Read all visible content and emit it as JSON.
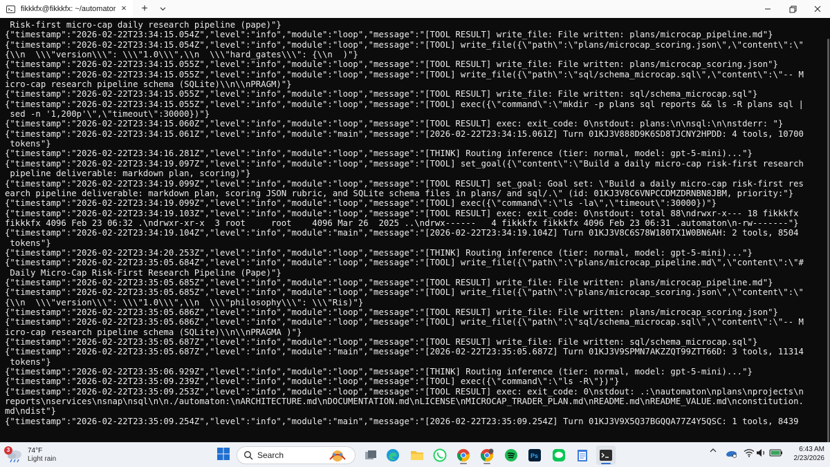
{
  "tab": {
    "title": "fikkkfx@fikkkfx: ~/automator",
    "icon": "terminal-icon",
    "close_label": "×",
    "new_tab_label": "+"
  },
  "terminal": {
    "lines": [
      " Risk-first micro-cap daily research pipeline (pape)\"}",
      "{\"timestamp\":\"2026-02-22T23:34:15.054Z\",\"level\":\"info\",\"module\":\"loop\",\"message\":\"[TOOL RESULT] write_file: File written: plans/microcap_pipeline.md\"}",
      "{\"timestamp\":\"2026-02-22T23:34:15.054Z\",\"level\":\"info\",\"module\":\"loop\",\"message\":\"[TOOL] write_file({\\\"path\\\":\\\"plans/microcap_scoring.json\\\",\\\"content\\\":\\\"",
      "{\\\\n  \\\\\\\"version\\\\\\\": \\\\\\\"1.0\\\\\\\",\\\\n  \\\\\\\"hard_gates\\\\\\\": {\\\\n  )\"}",
      "{\"timestamp\":\"2026-02-22T23:34:15.055Z\",\"level\":\"info\",\"module\":\"loop\",\"message\":\"[TOOL RESULT] write_file: File written: plans/microcap_scoring.json\"}",
      "{\"timestamp\":\"2026-02-22T23:34:15.055Z\",\"level\":\"info\",\"module\":\"loop\",\"message\":\"[TOOL] write_file({\\\"path\\\":\\\"sql/schema_microcap.sql\\\",\\\"content\\\":\\\"-- M",
      "icro-cap research pipeline schema (SQLite)\\\\n\\\\nPRAGM)\"}",
      "{\"timestamp\":\"2026-02-22T23:34:15.055Z\",\"level\":\"info\",\"module\":\"loop\",\"message\":\"[TOOL RESULT] write_file: File written: sql/schema_microcap.sql\"}",
      "{\"timestamp\":\"2026-02-22T23:34:15.055Z\",\"level\":\"info\",\"module\":\"loop\",\"message\":\"[TOOL] exec({\\\"command\\\":\\\"mkdir -p plans sql reports && ls -R plans sql |",
      " sed -n '1,200p'\\\",\\\"timeout\\\":30000})\"}",
      "{\"timestamp\":\"2026-02-22T23:34:15.060Z\",\"level\":\"info\",\"module\":\"loop\",\"message\":\"[TOOL RESULT] exec: exit_code: 0\\nstdout: plans:\\n\\nsql:\\n\\nstderr: \"}",
      "{\"timestamp\":\"2026-02-22T23:34:15.061Z\",\"level\":\"info\",\"module\":\"main\",\"message\":\"[2026-02-22T23:34:15.061Z] Turn 01KJ3V888D9K6SD8TJCNY2HPDD: 4 tools, 10700",
      " tokens\"}",
      "{\"timestamp\":\"2026-02-22T23:34:16.281Z\",\"level\":\"info\",\"module\":\"loop\",\"message\":\"[THINK] Routing inference (tier: normal, model: gpt-5-mini)...\"}",
      "{\"timestamp\":\"2026-02-22T23:34:19.097Z\",\"level\":\"info\",\"module\":\"loop\",\"message\":\"[TOOL] set_goal({\\\"content\\\":\\\"Build a daily micro-cap risk-first research",
      " pipeline deliverable: markdown plan, scoring)\"}",
      "{\"timestamp\":\"2026-02-22T23:34:19.099Z\",\"level\":\"info\",\"module\":\"loop\",\"message\":\"[TOOL RESULT] set_goal: Goal set: \\\"Build a daily micro-cap risk-first res",
      "earch pipeline deliverable: markdown plan, scoring JSON rubric, and SQLite schema files in plans/ and sql/.\\\" (id: 01KJ3V8C6VNPCCDMZDRNBN8JBM, priority:\"}",
      "{\"timestamp\":\"2026-02-22T23:34:19.099Z\",\"level\":\"info\",\"module\":\"loop\",\"message\":\"[TOOL] exec({\\\"command\\\":\\\"ls -la\\\",\\\"timeout\\\":30000})\"}",
      "{\"timestamp\":\"2026-02-22T23:34:19.103Z\",\"level\":\"info\",\"module\":\"loop\",\"message\":\"[TOOL RESULT] exec: exit_code: 0\\nstdout: total 88\\ndrwxr-x--- 18 fikkkfx",
      "fikkkfx 4096 Feb 23 06:32 .\\ndrwxr-xr-x  3 root     root    4096 Mar 26  2025 ..\\ndrwx------   4 fikkkfx fikkkfx 4096 Feb 23 06:31 .automaton\\n-rw-------\"}",
      "{\"timestamp\":\"2026-02-22T23:34:19.104Z\",\"level\":\"info\",\"module\":\"main\",\"message\":\"[2026-02-22T23:34:19.104Z] Turn 01KJ3V8C6S78W180TX1W0BN6AH: 2 tools, 8504",
      " tokens\"}",
      "{\"timestamp\":\"2026-02-22T23:34:20.253Z\",\"level\":\"info\",\"module\":\"loop\",\"message\":\"[THINK] Routing inference (tier: normal, model: gpt-5-mini)...\"}",
      "{\"timestamp\":\"2026-02-22T23:35:05.684Z\",\"level\":\"info\",\"module\":\"loop\",\"message\":\"[TOOL] write_file({\\\"path\\\":\\\"plans/microcap_pipeline.md\\\",\\\"content\\\":\\\"#",
      " Daily Micro-Cap Risk-First Research Pipeline (Pape)\"}",
      "{\"timestamp\":\"2026-02-22T23:35:05.685Z\",\"level\":\"info\",\"module\":\"loop\",\"message\":\"[TOOL RESULT] write_file: File written: plans/microcap_pipeline.md\"}",
      "{\"timestamp\":\"2026-02-22T23:35:05.685Z\",\"level\":\"info\",\"module\":\"loop\",\"message\":\"[TOOL] write_file({\\\"path\\\":\\\"plans/microcap_scoring.json\\\",\\\"content\\\":\\\"",
      "{\\\\n  \\\\\\\"version\\\\\\\": \\\\\\\"1.0\\\\\\\",\\\\n  \\\\\\\"philosophy\\\\\\\": \\\\\\\"Ris)\"}",
      "{\"timestamp\":\"2026-02-22T23:35:05.686Z\",\"level\":\"info\",\"module\":\"loop\",\"message\":\"[TOOL RESULT] write_file: File written: plans/microcap_scoring.json\"}",
      "{\"timestamp\":\"2026-02-22T23:35:05.686Z\",\"level\":\"info\",\"module\":\"loop\",\"message\":\"[TOOL] write_file({\\\"path\\\":\\\"sql/schema_microcap.sql\\\",\\\"content\\\":\\\"-- M",
      "icro-cap research pipeline schema (SQLite)\\\\n\\\\nPRAGMA )\"}",
      "{\"timestamp\":\"2026-02-22T23:35:05.687Z\",\"level\":\"info\",\"module\":\"loop\",\"message\":\"[TOOL RESULT] write_file: File written: sql/schema_microcap.sql\"}",
      "{\"timestamp\":\"2026-02-22T23:35:05.687Z\",\"level\":\"info\",\"module\":\"main\",\"message\":\"[2026-02-22T23:35:05.687Z] Turn 01KJ3V9SPMN7AKZZQT99ZTT66D: 3 tools, 11314",
      " tokens\"}",
      "{\"timestamp\":\"2026-02-22T23:35:06.929Z\",\"level\":\"info\",\"module\":\"loop\",\"message\":\"[THINK] Routing inference (tier: normal, model: gpt-5-mini)...\"}",
      "{\"timestamp\":\"2026-02-22T23:35:09.239Z\",\"level\":\"info\",\"module\":\"loop\",\"message\":\"[TOOL] exec({\\\"command\\\":\\\"ls -R\\\"})\"}",
      "{\"timestamp\":\"2026-02-22T23:35:09.253Z\",\"level\":\"info\",\"module\":\"loop\",\"message\":\"[TOOL RESULT] exec: exit_code: 0\\nstdout: .:\\nautomaton\\nplans\\nprojects\\n",
      "reports\\nservices\\nsnap\\nsql\\n\\n./automaton:\\nARCHITECTURE.md\\nDOCUMENTATION.md\\nLICENSE\\nMICROCAP_TRADER_PLAN.md\\nREADME.md\\nREADME_VALUE.md\\nconstitution.",
      "md\\ndist\"}",
      "{\"timestamp\":\"2026-02-22T23:35:09.254Z\",\"level\":\"info\",\"module\":\"main\",\"message\":\"[2026-02-22T23:35:09.254Z] Turn 01KJ3V9X5Q37BGQQA77Z4Y5QSC: 1 tools, 8439"
    ]
  },
  "taskbar": {
    "weather": {
      "temp": "74°F",
      "desc": "Light rain",
      "badge": "3"
    },
    "search_label": "Search",
    "clock": {
      "time": "6:43 AM",
      "date": "2/23/2026"
    }
  },
  "colors": {
    "terminal_bg": "#0c0c0c",
    "terminal_fg": "#ececec",
    "taskbar_bg": "#eef1f6",
    "titlebar_bg": "#fafafa"
  }
}
